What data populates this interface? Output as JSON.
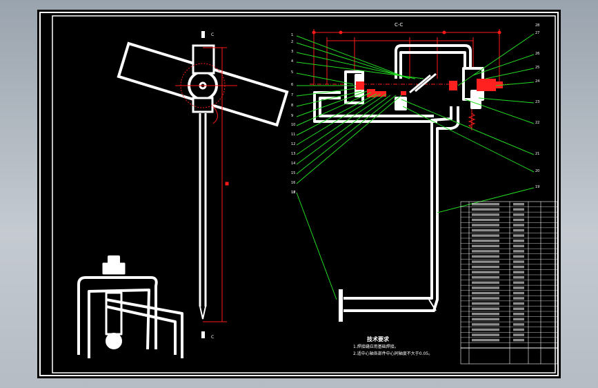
{
  "colors": {
    "outline": "#ffffff",
    "dimension": "#ff1a1a",
    "leader": "#22dd22",
    "background": "#000000"
  },
  "section_label": "C-C",
  "section_marks": [
    "C",
    "C"
  ],
  "callouts": [
    "1",
    "2",
    "3",
    "4",
    "5",
    "6",
    "7",
    "8",
    "9",
    "10",
    "11",
    "12",
    "13",
    "14",
    "15",
    "16",
    "17",
    "18",
    "19",
    "20",
    "21",
    "22",
    "23",
    "24",
    "25",
    "26",
    "27",
    "28"
  ],
  "notes": {
    "title": "技术要求",
    "lines": [
      "1.焊接缝应用基础焊接。",
      "2.适中心轴各部件中心同轴度不大于0.05。"
    ]
  },
  "bom_rows": 28
}
